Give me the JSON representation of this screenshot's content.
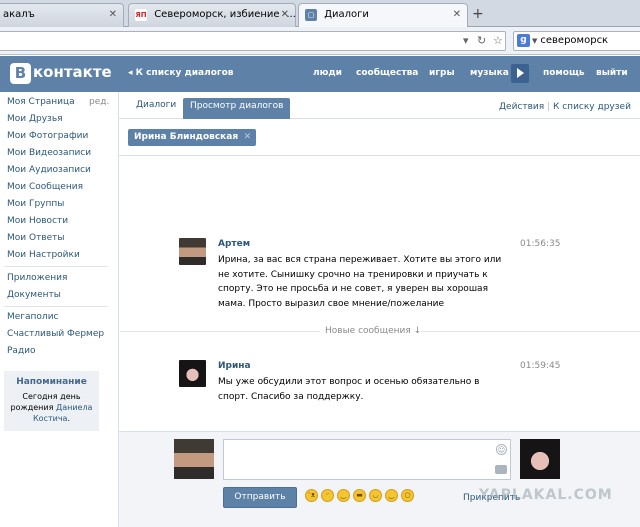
{
  "browser": {
    "tabs": [
      {
        "label": "акалъ",
        "favicon": ""
      },
      {
        "label": "Североморск, избиение -...",
        "favicon": "ЯП"
      },
      {
        "label": "Диалоги",
        "favicon": "vk-icon"
      }
    ],
    "search_value": "североморск"
  },
  "vk": {
    "logo": "контакте",
    "logo_letter": "В",
    "back_link": "К списку диалогов",
    "menu": [
      "люди",
      "сообщества",
      "игры",
      "музыка",
      "помощь",
      "выйти"
    ]
  },
  "sidebar": {
    "items": [
      "Моя Страница",
      "Мои Друзья",
      "Мои Фотографии",
      "Мои Видеозаписи",
      "Мои Аудиозаписи",
      "Мои Сообщения",
      "Мои Группы",
      "Мои Новости",
      "Мои Ответы",
      "Мои Настройки"
    ],
    "edit_label": "ред.",
    "apps": [
      "Приложения",
      "Документы"
    ],
    "games": [
      "Мегаполис",
      "Счастливый Фермер",
      "Радио"
    ],
    "reminder": {
      "title": "Напоминание",
      "line1": "Сегодня",
      "line1_b": "день",
      "line2": "рождения",
      "name_first": "Даниела",
      "name_last": "Костича",
      "suffix": "."
    }
  },
  "content": {
    "tabs": [
      "Диалоги",
      "Просмотр диалогов"
    ],
    "actions_link": "Действия",
    "sep": "|",
    "friends_link": "К списку друзей",
    "chip": "Ирина Блиндовская",
    "messages": [
      {
        "author": "Артем",
        "time": "01:56:35",
        "text": "Ирина, за вас вся страна переживает. Хотите вы этого или не хотите. Сынишку срочно на тренировки и приучать к спорту. Это не просьба и не совет, я уверен вы хорошая мама. Просто выразил свое мнение/пожелание"
      },
      {
        "author": "Ирина",
        "time": "01:59:45",
        "text": "Мы уже обсудили этот вопрос и осенью обязательно в спорт. Спасибо за поддержку."
      }
    ],
    "new_messages": "Новые сообщения ↓",
    "composer": {
      "send_label": "Отправить",
      "attach_label": "Прикрепить",
      "watermark": "YAPLAKAL.COM"
    }
  }
}
